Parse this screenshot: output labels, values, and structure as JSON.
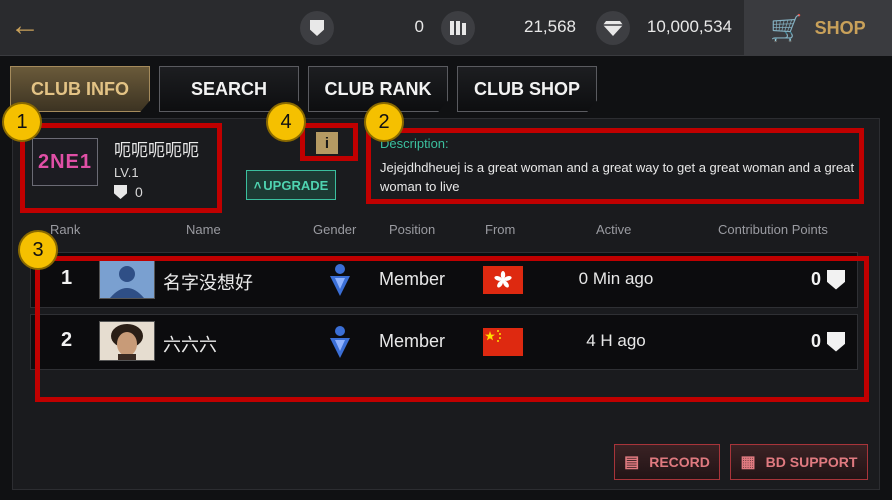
{
  "topbar": {
    "back_icon": "back-arrow-icon",
    "resources": [
      {
        "icon": "shield-star-icon",
        "value": "0"
      },
      {
        "icon": "cards-icon",
        "value": "21,568"
      },
      {
        "icon": "diamond-icon",
        "value": "10,000,534"
      }
    ],
    "shop_label": "SHOP"
  },
  "tabs": [
    {
      "label": "CLUB INFO",
      "active": true
    },
    {
      "label": "SEARCH",
      "active": false
    },
    {
      "label": "CLUB RANK",
      "active": false
    },
    {
      "label": "CLUB SHOP",
      "active": false
    }
  ],
  "club": {
    "logo_text": "2NE1",
    "name": "呃呃呃呃呃",
    "level": "LV.1",
    "points": "0",
    "info_label": "i",
    "upgrade_label": "UPGRADE",
    "description_label": "Description:",
    "description": "Jejejdhdheuej is a great woman and a great way to get a great woman and a great woman to live"
  },
  "table": {
    "headers": [
      "Rank",
      "Name",
      "Gender",
      "Position",
      "From",
      "Active",
      "Contribution Points"
    ],
    "rows": [
      {
        "rank": "1",
        "name": "名字没想好",
        "position": "Member",
        "from": "Hong Kong",
        "active": "0 Min ago",
        "points": "0"
      },
      {
        "rank": "2",
        "name": "六六六",
        "position": "Member",
        "from": "China",
        "active": "4 H ago",
        "points": "0"
      }
    ]
  },
  "buttons": {
    "record": "RECORD",
    "bd_support": "BD SUPPORT"
  },
  "annotations": [
    "1",
    "2",
    "3",
    "4"
  ],
  "colors": {
    "accent_gold": "#c9a15a",
    "highlight_red": "#c00000",
    "badge_yellow": "#f5c000",
    "teal": "#3bbf9e"
  }
}
